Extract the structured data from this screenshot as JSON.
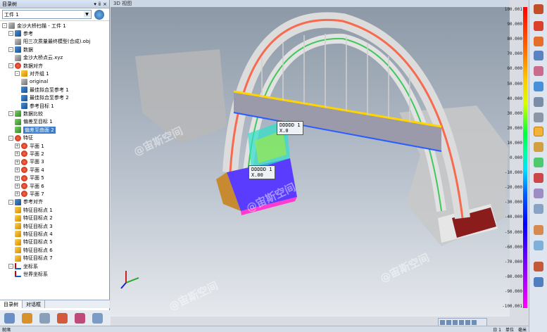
{
  "left_panel": {
    "title": "目录树",
    "part_select": "工件 1",
    "tabs": [
      "目录树",
      "对话框"
    ]
  },
  "tree": [
    {
      "depth": 0,
      "exp": "-",
      "icon": "gray",
      "label": "金沙大桥扫描 - 工件 1"
    },
    {
      "depth": 1,
      "exp": "-",
      "icon": "blue",
      "label": "参考"
    },
    {
      "depth": 2,
      "exp": "",
      "icon": "gray",
      "label": "阳三次质量最终模型(合成).obj"
    },
    {
      "depth": 1,
      "exp": "-",
      "icon": "blue",
      "label": "数据"
    },
    {
      "depth": 2,
      "exp": "",
      "icon": "gray",
      "label": "金沙大桥点云.xyz"
    },
    {
      "depth": 1,
      "exp": "-",
      "icon": "red",
      "label": "数据对齐"
    },
    {
      "depth": 2,
      "exp": "-",
      "icon": "sel",
      "label": "对齐组 1"
    },
    {
      "depth": 3,
      "exp": "",
      "icon": "gray",
      "label": "original"
    },
    {
      "depth": 3,
      "exp": "",
      "icon": "blue",
      "label": "最佳拟合至参考 1"
    },
    {
      "depth": 3,
      "exp": "",
      "icon": "blue",
      "label": "最佳拟合至参考 2"
    },
    {
      "depth": 3,
      "exp": "",
      "icon": "blue",
      "label": "参考目标 1"
    },
    {
      "depth": 1,
      "exp": "-",
      "icon": "green",
      "label": "数据比较"
    },
    {
      "depth": 2,
      "exp": "",
      "icon": "green",
      "label": "偏差至目标 1"
    },
    {
      "depth": 2,
      "exp": "",
      "icon": "green",
      "label": "偏差至曲面 2",
      "selected": true
    },
    {
      "depth": 1,
      "exp": "-",
      "icon": "red",
      "label": "特征"
    },
    {
      "depth": 2,
      "exp": "+",
      "icon": "red",
      "label": "平面 1"
    },
    {
      "depth": 2,
      "exp": "+",
      "icon": "red",
      "label": "平面 2"
    },
    {
      "depth": 2,
      "exp": "+",
      "icon": "red",
      "label": "平面 3"
    },
    {
      "depth": 2,
      "exp": "+",
      "icon": "red",
      "label": "平面 4"
    },
    {
      "depth": 2,
      "exp": "+",
      "icon": "red",
      "label": "平面 5"
    },
    {
      "depth": 2,
      "exp": "+",
      "icon": "red",
      "label": "平面 6"
    },
    {
      "depth": 2,
      "exp": "+",
      "icon": "red",
      "label": "平面 7"
    },
    {
      "depth": 1,
      "exp": "-",
      "icon": "blue",
      "label": "参考对齐"
    },
    {
      "depth": 2,
      "exp": "",
      "icon": "sel",
      "label": "特征目标点 1"
    },
    {
      "depth": 2,
      "exp": "",
      "icon": "sel",
      "label": "特征目标点 2"
    },
    {
      "depth": 2,
      "exp": "",
      "icon": "sel",
      "label": "特征目标点 3"
    },
    {
      "depth": 2,
      "exp": "",
      "icon": "sel",
      "label": "特征目标点 4"
    },
    {
      "depth": 2,
      "exp": "",
      "icon": "sel",
      "label": "特征目标点 5"
    },
    {
      "depth": 2,
      "exp": "",
      "icon": "sel",
      "label": "特征目标点 6"
    },
    {
      "depth": 2,
      "exp": "",
      "icon": "sel",
      "label": "特征目标点 7"
    },
    {
      "depth": 1,
      "exp": "-",
      "icon": "axis",
      "label": "坐标系"
    },
    {
      "depth": 2,
      "exp": "",
      "icon": "axis",
      "label": "世界坐标系"
    }
  ],
  "viewport": {
    "title": "3D 视图",
    "callouts": [
      {
        "id": "callout-1",
        "lines": [
          "DDDDD 1",
          "X.0"
        ]
      },
      {
        "id": "callout-2",
        "lines": [
          "DDDDD 1",
          "X.00"
        ]
      }
    ],
    "watermark": "@宙斯空间"
  },
  "color_scale": {
    "ticks": [
      "100.001",
      "90.000",
      "80.000",
      "70.000",
      "60.000",
      "50.000",
      "40.000",
      "30.000",
      "20.000",
      "10.000",
      "0.000",
      "-10.000",
      "-20.000",
      "-30.000",
      "-40.000",
      "-50.000",
      "-60.000",
      "-70.000",
      "-80.000",
      "-90.000",
      "-100.001"
    ]
  },
  "statusbar": {
    "left": "就绪",
    "right": [
      "日 1",
      "单位",
      "毫米"
    ]
  },
  "colors": {
    "selection": "#3d7cc9",
    "panel_title": "#c4d3e6"
  }
}
